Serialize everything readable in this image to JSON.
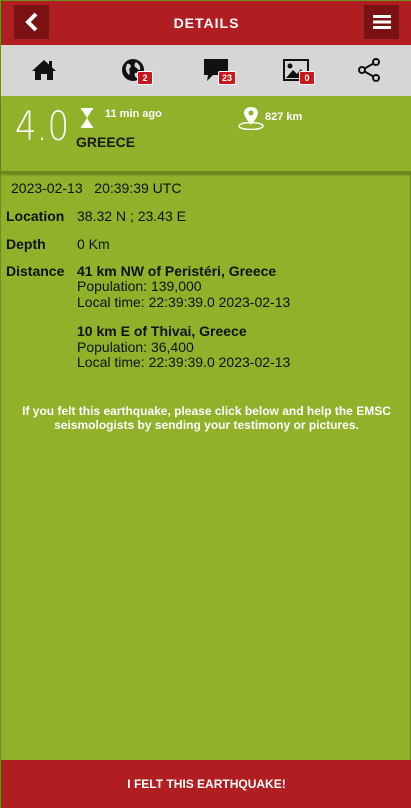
{
  "header": {
    "title": "DETAILS"
  },
  "icons": {
    "earth_badge": "2",
    "comments_badge": "23",
    "pictures_badge": "0"
  },
  "summary": {
    "magnitude": "4.0",
    "time_ago": "11 min ago",
    "region": "GREECE",
    "distance": "827 km"
  },
  "details": {
    "datetime": "2023-02-13   20:39:39 UTC",
    "location_label": "Location",
    "location_value": "38.32 N ; 23.43 E",
    "depth_label": "Depth",
    "depth_value": "0 Km",
    "distance_label": "Distance",
    "places": [
      {
        "name": "41 km NW of Peristéri, Greece",
        "population": "Population: 139,000",
        "local_time": "Local time: 22:39:39.0 2023-02-13"
      },
      {
        "name": "10 km E of Thivai, Greece",
        "population": "Population: 36,400",
        "local_time": "Local time: 22:39:39.0 2023-02-13"
      }
    ]
  },
  "prompt": "If you felt this earthquake, please click below and help the EMSC seismologists by sending your testimony or pictures.",
  "felt_button": "I FELT THIS EARTHQUAKE!",
  "colors": {
    "accent": "#b01e22",
    "background": "#8fb22a",
    "toolbar": "#d6d6d6"
  }
}
